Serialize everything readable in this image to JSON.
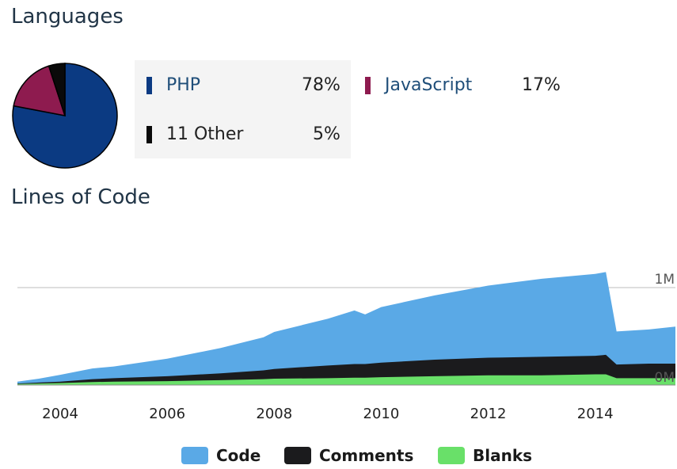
{
  "sections": {
    "languages_title": "Languages",
    "loc_title": "Lines of Code"
  },
  "languages": [
    {
      "name": "PHP",
      "percent": "78%",
      "value": 78,
      "color": "#0b3a82"
    },
    {
      "name": "JavaScript",
      "percent": "17%",
      "value": 17,
      "color": "#8e1b4f"
    },
    {
      "name": "11 Other",
      "percent": "5%",
      "value": 5,
      "color": "#0a0a0a"
    }
  ],
  "chart_data": {
    "type": "area",
    "title": "Lines of Code",
    "xlabel": "",
    "ylabel": "",
    "x_ticks": [
      "2004",
      "2006",
      "2008",
      "2010",
      "2012",
      "2014"
    ],
    "y_ticks": [
      "0M",
      "1M"
    ],
    "ylim": [
      0,
      1.35
    ],
    "stacked": true,
    "legend_position": "bottom",
    "x": [
      2003.2,
      2003.6,
      2004.0,
      2004.6,
      2005.0,
      2006.0,
      2007.0,
      2007.8,
      2008.0,
      2009.0,
      2009.5,
      2009.7,
      2010.0,
      2011.0,
      2012.0,
      2013.0,
      2014.0,
      2014.2,
      2014.4,
      2015.0,
      2015.5
    ],
    "series": [
      {
        "name": "Code",
        "color": "#5aa9e6",
        "values": [
          0.02,
          0.04,
          0.07,
          0.11,
          0.12,
          0.18,
          0.26,
          0.34,
          0.38,
          0.48,
          0.55,
          0.51,
          0.57,
          0.66,
          0.74,
          0.8,
          0.84,
          0.85,
          0.34,
          0.35,
          0.38
        ]
      },
      {
        "name": "Comments",
        "color": "#1b1b1d",
        "values": [
          0.005,
          0.01,
          0.015,
          0.03,
          0.035,
          0.05,
          0.07,
          0.09,
          0.1,
          0.13,
          0.14,
          0.14,
          0.15,
          0.17,
          0.18,
          0.19,
          0.19,
          0.2,
          0.14,
          0.15,
          0.15
        ]
      },
      {
        "name": "Blanks",
        "color": "#69e069",
        "values": [
          0.01,
          0.015,
          0.02,
          0.03,
          0.035,
          0.04,
          0.05,
          0.06,
          0.065,
          0.07,
          0.075,
          0.075,
          0.08,
          0.09,
          0.1,
          0.1,
          0.11,
          0.11,
          0.07,
          0.07,
          0.07
        ]
      }
    ]
  }
}
